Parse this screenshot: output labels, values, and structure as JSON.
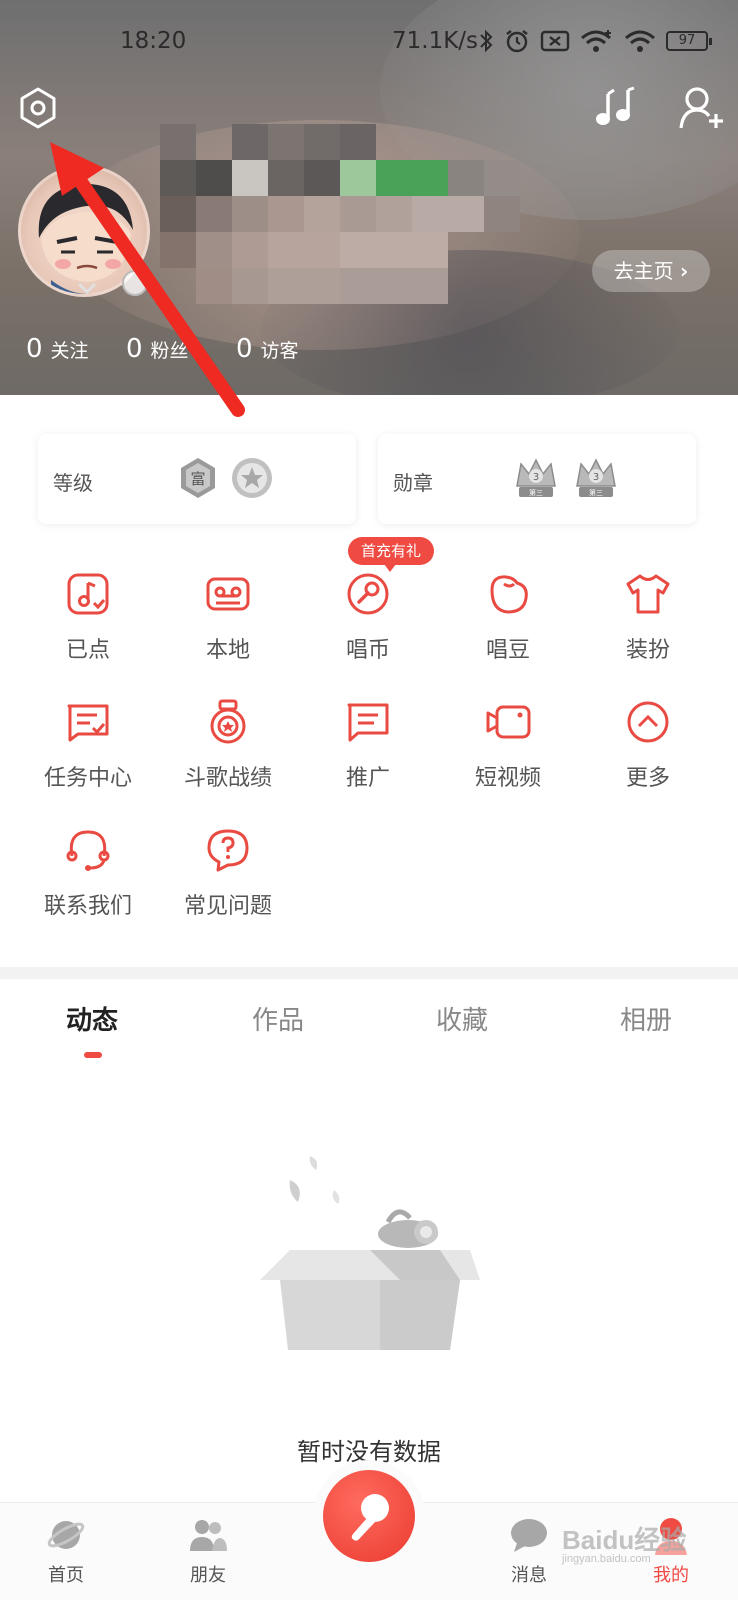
{
  "status_bar": {
    "time": "18:20",
    "speed": "71.1K/s",
    "battery": "97",
    "icons": [
      "bluetooth-icon",
      "alarm-icon",
      "sim-off-icon",
      "wifi-plus-icon",
      "wifi-icon",
      "battery-icon"
    ]
  },
  "header": {
    "icons": [
      "settings-icon",
      "music-notes-icon",
      "add-user-icon"
    ],
    "homepage_label": "去主页",
    "stats": [
      {
        "count": "0",
        "label": "关注"
      },
      {
        "count": "0",
        "label": "粉丝"
      },
      {
        "count": "0",
        "label": "访客"
      }
    ]
  },
  "cards": {
    "level_label": "等级",
    "level_badge_text": "富",
    "medal_label": "勋章",
    "medal_rank_text": "3",
    "medal_sub_text": "第三"
  },
  "promo_tag": "首充有礼",
  "features": [
    {
      "label": "已点",
      "icon": "music-note-doc-icon"
    },
    {
      "label": "本地",
      "icon": "cassette-icon"
    },
    {
      "label": "唱币",
      "icon": "mic-coin-icon"
    },
    {
      "label": "唱豆",
      "icon": "bean-icon"
    },
    {
      "label": "装扮",
      "icon": "tshirt-icon"
    },
    {
      "label": "任务中心",
      "icon": "task-icon"
    },
    {
      "label": "斗歌战绩",
      "icon": "medal-icon"
    },
    {
      "label": "推广",
      "icon": "message-icon"
    },
    {
      "label": "短视频",
      "icon": "video-icon"
    },
    {
      "label": "更多",
      "icon": "chevron-up-icon"
    },
    {
      "label": "联系我们",
      "icon": "headset-icon"
    },
    {
      "label": "常见问题",
      "icon": "help-icon"
    }
  ],
  "tabs": [
    {
      "label": "动态",
      "active": true
    },
    {
      "label": "作品",
      "active": false
    },
    {
      "label": "收藏",
      "active": false
    },
    {
      "label": "相册",
      "active": false
    }
  ],
  "empty_text": "暂时没有数据",
  "bottom_nav": [
    {
      "label": "首页",
      "icon": "planet-icon"
    },
    {
      "label": "朋友",
      "icon": "friends-icon"
    },
    {
      "label": "消息",
      "icon": "chat-icon"
    },
    {
      "label": "我的",
      "icon": "me-icon",
      "active": true
    }
  ],
  "watermark": {
    "text": "Baidu经验",
    "sub": "jingyan.baidu.com"
  },
  "colors": {
    "accent": "#ef4b43",
    "text_muted": "#888888",
    "divider": "#f2f2f2"
  }
}
